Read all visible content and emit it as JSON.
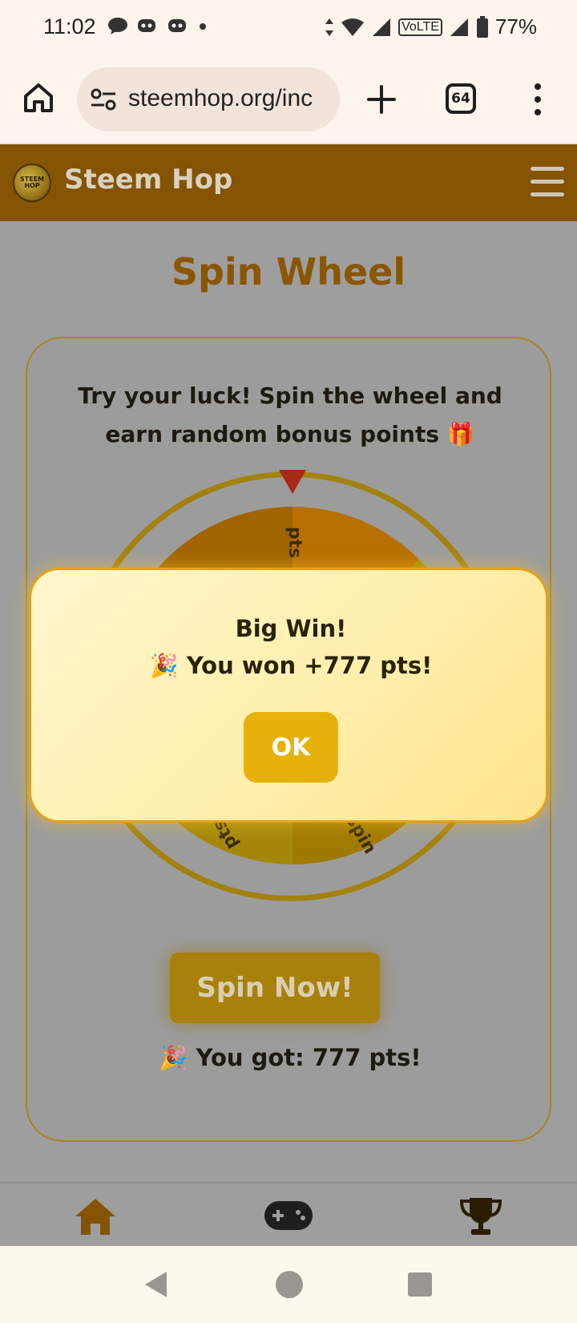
{
  "status_bar": {
    "time": "11:02",
    "network": "VoLTE",
    "battery": "77%"
  },
  "browser": {
    "url": "steemhop.org/inc",
    "tab_count": "64"
  },
  "app": {
    "title": "Steem Hop",
    "logo_text": "STEEM HOP"
  },
  "page": {
    "title": "Spin Wheel",
    "description": "Try your luck! Spin the wheel and earn random bonus points 🎁",
    "wheel_labels": [
      "pts",
      "pts",
      "spin"
    ],
    "spin_button": "Spin Now!",
    "result": "🎉 You got: 777 pts!"
  },
  "modal": {
    "title": "Big Win!",
    "message": "🎉 You won +777 pts!",
    "ok_label": "OK"
  },
  "bottom_nav": {
    "items": [
      "home-icon",
      "gamepad-icon",
      "trophy-icon"
    ]
  },
  "colors": {
    "header": "#845403",
    "accent": "#e6b10b",
    "modal_border": "#e5a11a",
    "title": "#8a5600"
  }
}
